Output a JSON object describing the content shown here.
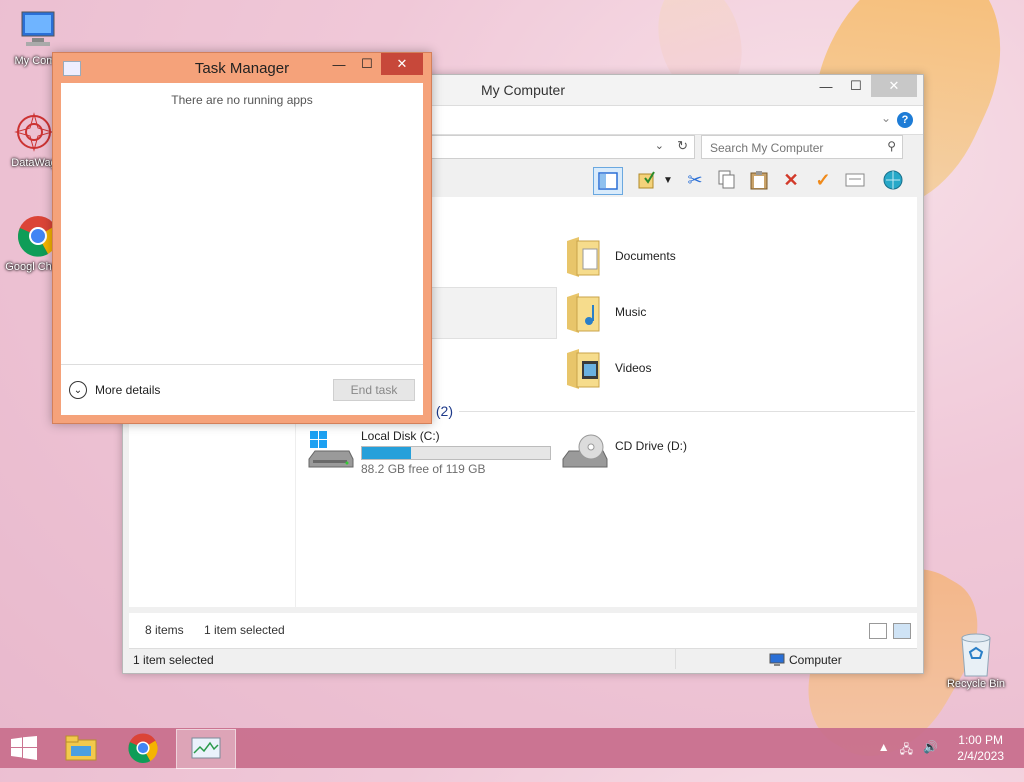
{
  "desktop": {
    "icons": [
      {
        "label": "My Comp"
      },
      {
        "label": "DataWag"
      },
      {
        "label": "Googl Chrom"
      }
    ],
    "recycle_bin": {
      "label": "Recycle Bin"
    }
  },
  "explorer": {
    "title": "My Computer",
    "search_placeholder": "Search My Computer",
    "folders": [
      {
        "name": "Documents"
      },
      {
        "name": "Music"
      },
      {
        "name": "Videos"
      }
    ],
    "section_heading": "s (2)",
    "drives": [
      {
        "name": "Local Disk (C:)",
        "free_text": "88.2 GB free of 119 GB",
        "used_fraction": 0.26
      },
      {
        "name": "CD Drive (D:)"
      }
    ],
    "status": {
      "items": "8 items",
      "selected": "1 item selected",
      "bar_left": "1 item selected",
      "bar_right": "Computer"
    }
  },
  "task_manager": {
    "title": "Task Manager",
    "empty_message": "There are no running apps",
    "more_details": "More details",
    "end_task": "End task"
  },
  "taskbar": {
    "time": "1:00 PM",
    "date": "2/4/2023"
  }
}
